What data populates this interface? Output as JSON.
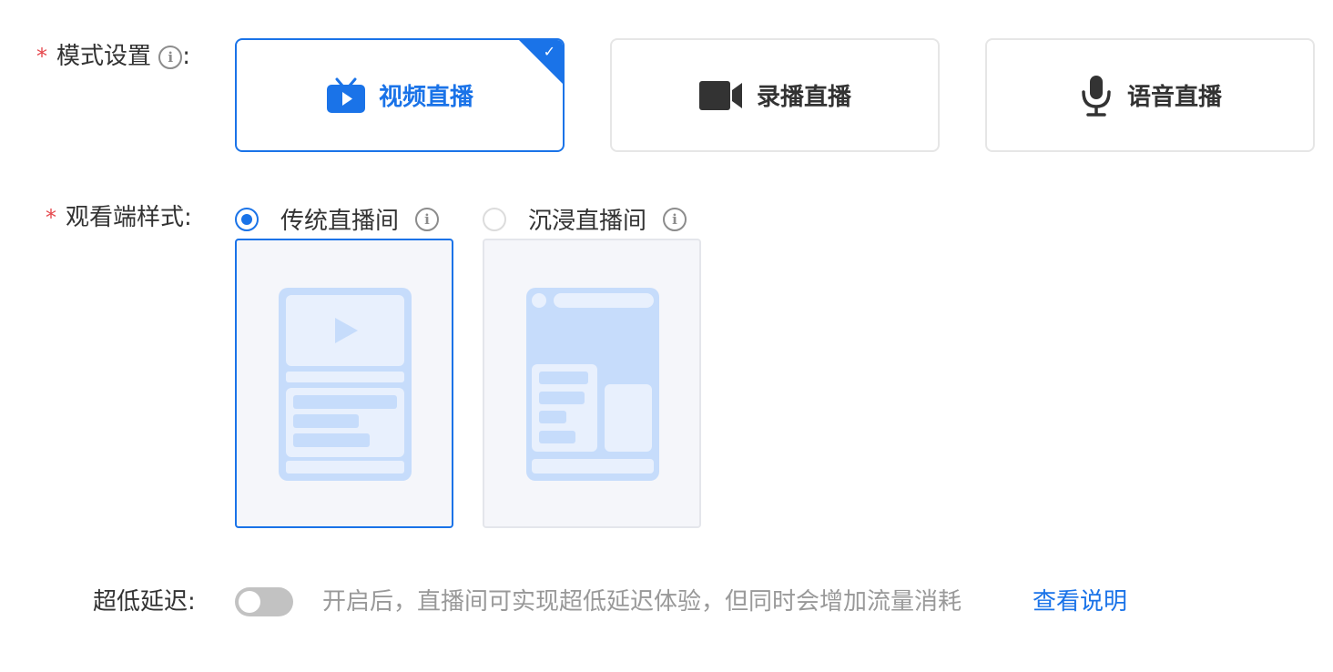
{
  "mode_setting": {
    "required_mark": "*",
    "label": "模式设置",
    "colon": ":",
    "info_icon": "info-icon",
    "options": [
      {
        "label": "视频直播",
        "icon": "tv-play-icon",
        "selected": true
      },
      {
        "label": "录播直播",
        "icon": "video-camera-icon",
        "selected": false
      },
      {
        "label": "语音直播",
        "icon": "microphone-icon",
        "selected": false
      }
    ],
    "selected_check": "✓"
  },
  "viewer_style": {
    "required_mark": "*",
    "label": "观看端样式",
    "colon": ":",
    "options": [
      {
        "label": "传统直播间",
        "checked": true,
        "info_icon": "info-icon"
      },
      {
        "label": "沉浸直播间",
        "checked": false,
        "info_icon": "info-icon"
      }
    ]
  },
  "low_latency": {
    "label": "超低延迟",
    "colon": ":",
    "toggle_on": false,
    "hint": "开启后，直播间可实现超低延迟体验，但同时会增加流量消耗",
    "link": "查看说明"
  },
  "colors": {
    "accent": "#1a73e8",
    "required": "#e5484d",
    "illustration": "#c6dcfb",
    "illustration_light": "#e8f0fd"
  }
}
